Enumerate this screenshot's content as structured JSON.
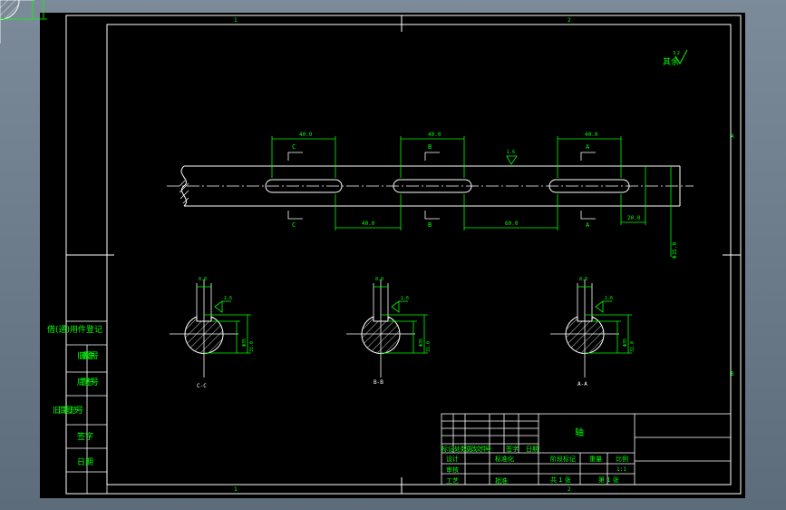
{
  "colors": {
    "background": "#000000",
    "frame": "#ffffff",
    "dimension": "#00ff00",
    "text": "#00ff00",
    "centerline": "#ffffff",
    "hatch": "#ffffff",
    "viewport": "#6e7d8c"
  },
  "zones": {
    "top": [
      "1",
      "2"
    ],
    "right": [
      "A",
      "B"
    ],
    "bottom": [
      "1",
      "2"
    ]
  },
  "roughness_note": "其余",
  "roughness_symbol_value": "3.2",
  "shaft": {
    "surface_roughness": "1.6",
    "dims_top": [
      "40.0",
      "40.0",
      "40.0"
    ],
    "dims_bottom": [
      "40.0",
      "60.0",
      "20.0"
    ],
    "diameter": "Φ35.0",
    "section_markers": [
      "C",
      "B",
      "A"
    ]
  },
  "sections": [
    {
      "id": "C",
      "label": "C-C",
      "keyway_width": "8.0",
      "roughness": "1.6",
      "depth_a": "Φ35",
      "depth_b": "31.0"
    },
    {
      "id": "B",
      "label": "B-B",
      "keyway_width": "8.0",
      "roughness": "1.6",
      "depth_a": "Φ35",
      "depth_b": "31.0"
    },
    {
      "id": "A",
      "label": "A-A",
      "keyway_width": "8.0",
      "roughness": "1.6",
      "depth_a": "Φ35",
      "depth_b": "31.0"
    }
  ],
  "side_table": [
    "借(通)用件登记",
    "旧底图总号",
    "底图总号",
    "签字",
    "日期"
  ],
  "title_block": {
    "part_name": "轴",
    "header_row": [
      "标记",
      "处数",
      "更改文件号",
      "签字",
      "日期"
    ],
    "rows": [
      "设计",
      "审核",
      "工艺"
    ],
    "standard": "标准化",
    "approval": "批准",
    "stage": "阶段标记",
    "weight": "重量",
    "scale": "比例",
    "scale_value": "1:1",
    "sheet_total": "共 1 张",
    "sheet_no": "第 1 张"
  }
}
